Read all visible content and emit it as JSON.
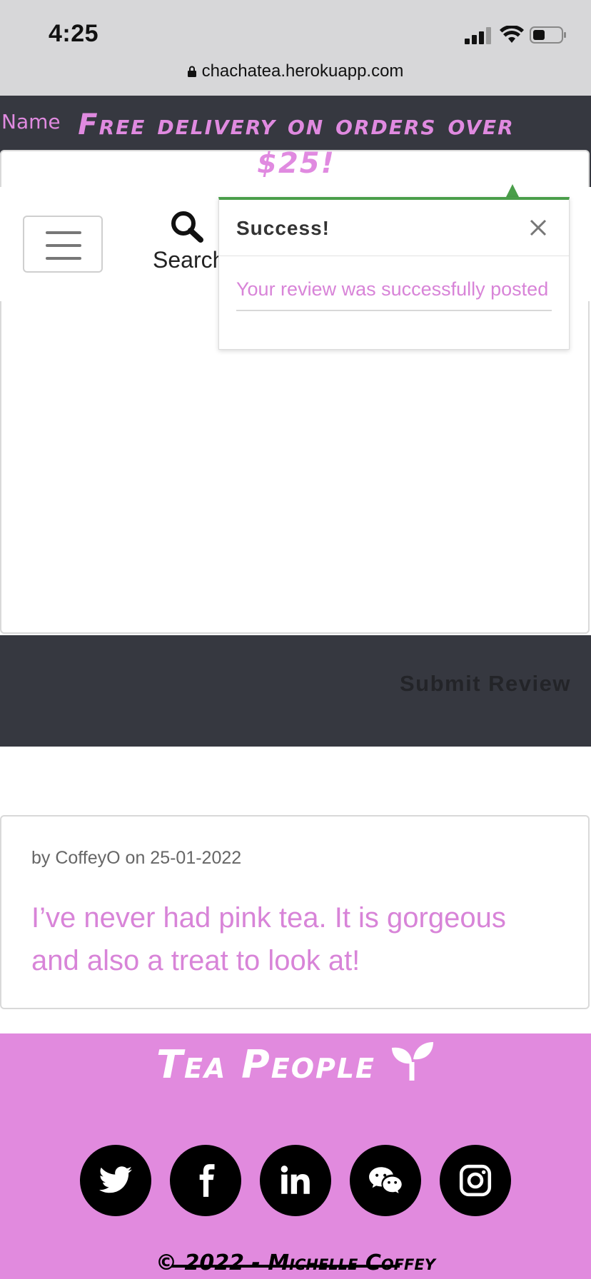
{
  "status_bar": {
    "time": "4:25"
  },
  "browser": {
    "url": "chachatea.herokuapp.com"
  },
  "header": {
    "name_label": "Name",
    "promo_line1": "Free delivery on orders over",
    "promo_line2": "$25!",
    "search_label": "Search"
  },
  "toast": {
    "title": "Success!",
    "message": "Your review was successfully posted"
  },
  "form": {
    "submit_label": "Submit Review"
  },
  "review": {
    "meta": "by CoffeyO on 25-01-2022",
    "text": "I’ve never had pink tea. It is gorgeous and also a treat to look at!"
  },
  "footer": {
    "brand": "Tea People",
    "social": [
      "twitter-icon",
      "facebook-icon",
      "linkedin-icon",
      "wechat-icon",
      "instagram-icon"
    ],
    "copyright": "© 2022 - Michelle Coffey"
  },
  "colors": {
    "accent_pink": "#e18ade",
    "dark_band": "#363840",
    "success_green": "#4a9e4a"
  }
}
